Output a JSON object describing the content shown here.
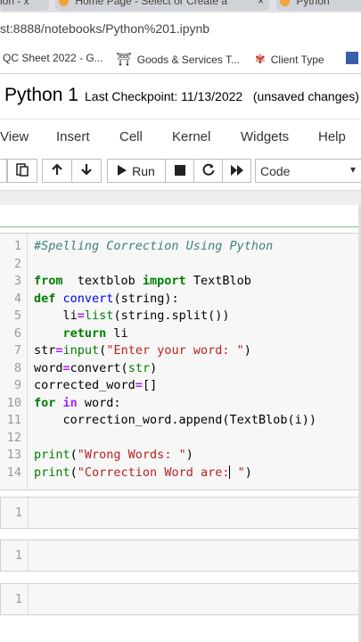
{
  "browser": {
    "tabs": [
      {
        "label": "ion - x"
      },
      {
        "label": "Home Page - Select or Create a",
        "close": "×"
      },
      {
        "label": "Python"
      }
    ],
    "url": "st:8888/notebooks/Python%201.ipynb",
    "bookmarks": [
      {
        "label": "QC Sheet 2022 - G...",
        "icon": "sheet-icon"
      },
      {
        "label": "Goods & Services T...",
        "icon": "emblem-icon"
      },
      {
        "label": "Client Type",
        "icon": "client-logo-icon"
      }
    ]
  },
  "notebook": {
    "name": "Python 1",
    "checkpoint": "Last Checkpoint: 11/13/2022",
    "status": "(unsaved changes)"
  },
  "menu": [
    "View",
    "Insert",
    "Cell",
    "Kernel",
    "Widgets",
    "Help"
  ],
  "toolbar": {
    "run_label": "Run",
    "cell_type": "Code"
  },
  "cell": {
    "line_numbers": [
      "1",
      "2",
      "3",
      "4",
      "5",
      "6",
      "7",
      "8",
      "9",
      "10",
      "11",
      "12",
      "13",
      "14"
    ]
  },
  "empty_cells": [
    {
      "line": "1"
    },
    {
      "line": "1"
    },
    {
      "line": "1"
    }
  ],
  "colors": {
    "keyword": "#008000",
    "string": "#ba2121",
    "comment": "#408080",
    "function": "#0000ff",
    "selected_cell_border": "#7cc47c"
  }
}
